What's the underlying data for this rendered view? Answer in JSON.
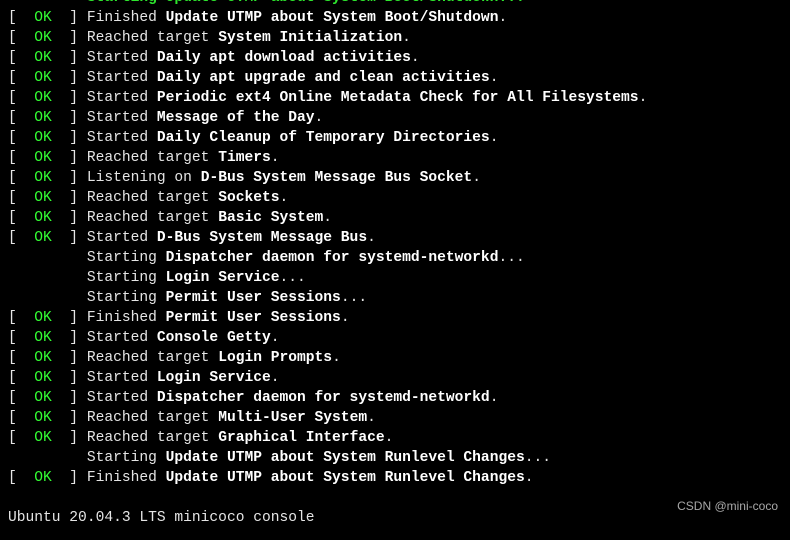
{
  "terminal": {
    "partial_top": "Starting Update UTMP about System Boot/Shutdown...",
    "lines": [
      {
        "status": "OK",
        "verb": "Finished",
        "unit": "Update UTMP about System Boot/Shutdown",
        "suffix": "."
      },
      {
        "status": "OK",
        "verb": "Reached target",
        "unit": "System Initialization",
        "suffix": "."
      },
      {
        "status": "OK",
        "verb": "Started",
        "unit": "Daily apt download activities",
        "suffix": "."
      },
      {
        "status": "OK",
        "verb": "Started",
        "unit": "Daily apt upgrade and clean activities",
        "suffix": "."
      },
      {
        "status": "OK",
        "verb": "Started",
        "unit": "Periodic ext4 Online Metadata Check for All Filesystems",
        "suffix": "."
      },
      {
        "status": "OK",
        "verb": "Started",
        "unit": "Message of the Day",
        "suffix": "."
      },
      {
        "status": "OK",
        "verb": "Started",
        "unit": "Daily Cleanup of Temporary Directories",
        "suffix": "."
      },
      {
        "status": "OK",
        "verb": "Reached target",
        "unit": "Timers",
        "suffix": "."
      },
      {
        "status": "OK",
        "verb": "Listening on",
        "unit": "D-Bus System Message Bus Socket",
        "suffix": "."
      },
      {
        "status": "OK",
        "verb": "Reached target",
        "unit": "Sockets",
        "suffix": "."
      },
      {
        "status": "OK",
        "verb": "Reached target",
        "unit": "Basic System",
        "suffix": "."
      },
      {
        "status": "OK",
        "verb": "Started",
        "unit": "D-Bus System Message Bus",
        "suffix": "."
      },
      {
        "status": null,
        "verb": "Starting",
        "unit": "Dispatcher daemon for systemd-networkd",
        "suffix": "..."
      },
      {
        "status": null,
        "verb": "Starting",
        "unit": "Login Service",
        "suffix": "..."
      },
      {
        "status": null,
        "verb": "Starting",
        "unit": "Permit User Sessions",
        "suffix": "..."
      },
      {
        "status": "OK",
        "verb": "Finished",
        "unit": "Permit User Sessions",
        "suffix": "."
      },
      {
        "status": "OK",
        "verb": "Started",
        "unit": "Console Getty",
        "suffix": "."
      },
      {
        "status": "OK",
        "verb": "Reached target",
        "unit": "Login Prompts",
        "suffix": "."
      },
      {
        "status": "OK",
        "verb": "Started",
        "unit": "Login Service",
        "suffix": "."
      },
      {
        "status": "OK",
        "verb": "Started",
        "unit": "Dispatcher daemon for systemd-networkd",
        "suffix": "."
      },
      {
        "status": "OK",
        "verb": "Reached target",
        "unit": "Multi-User System",
        "suffix": "."
      },
      {
        "status": "OK",
        "verb": "Reached target",
        "unit": "Graphical Interface",
        "suffix": "."
      },
      {
        "status": null,
        "verb": "Starting",
        "unit": "Update UTMP about System Runlevel Changes",
        "suffix": "..."
      },
      {
        "status": "OK",
        "verb": "Finished",
        "unit": "Update UTMP about System Runlevel Changes",
        "suffix": "."
      }
    ],
    "banner": "Ubuntu 20.04.3 LTS minicoco console"
  },
  "watermark": "CSDN @mini-coco"
}
